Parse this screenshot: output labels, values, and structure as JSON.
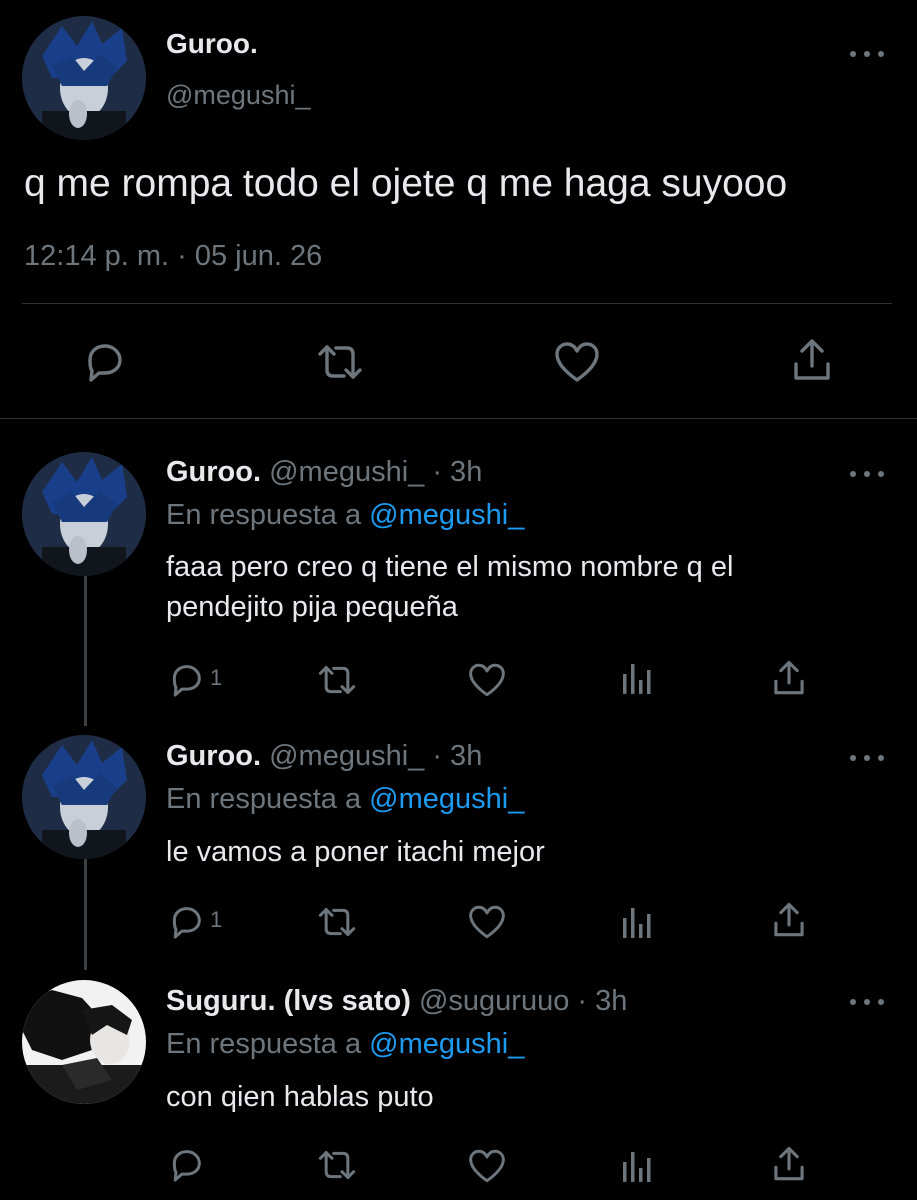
{
  "main_tweet": {
    "display_name": "Guroo.",
    "handle": "@megushi_",
    "text": "q me rompa todo el ojete q me haga suyooo",
    "timestamp": "12:14 p. m. · 05 jun. 26",
    "actions": [
      "reply-icon",
      "retweet-icon",
      "like-icon",
      "share-icon"
    ]
  },
  "replies": [
    {
      "display_name": "Guroo.",
      "meta": "@megushi_ · 3h",
      "replying_label": "En respuesta a",
      "replying_to": "@megushi_",
      "text_lines": [
        "faaa pero creo q tiene el mismo nombre q el",
        "pendejito pija pequeña"
      ],
      "reply_count": "1"
    },
    {
      "display_name": "Guroo.",
      "meta": "@megushi_ · 3h",
      "replying_label": "En respuesta a",
      "replying_to": "@megushi_",
      "text_lines": [
        "le vamos a poner itachi mejor"
      ],
      "reply_count": "1"
    },
    {
      "display_name": "Suguru. (lvs sato)",
      "meta": "@suguruuo · 3h",
      "replying_label": "En respuesta a",
      "replying_to": "@megushi_",
      "text_lines": [
        "con qien hablas puto"
      ],
      "reply_count": ""
    }
  ],
  "colors": {
    "background": "#000000",
    "text": "#e7e9ea",
    "muted": "#6e767d",
    "link": "#1d9bf0"
  }
}
